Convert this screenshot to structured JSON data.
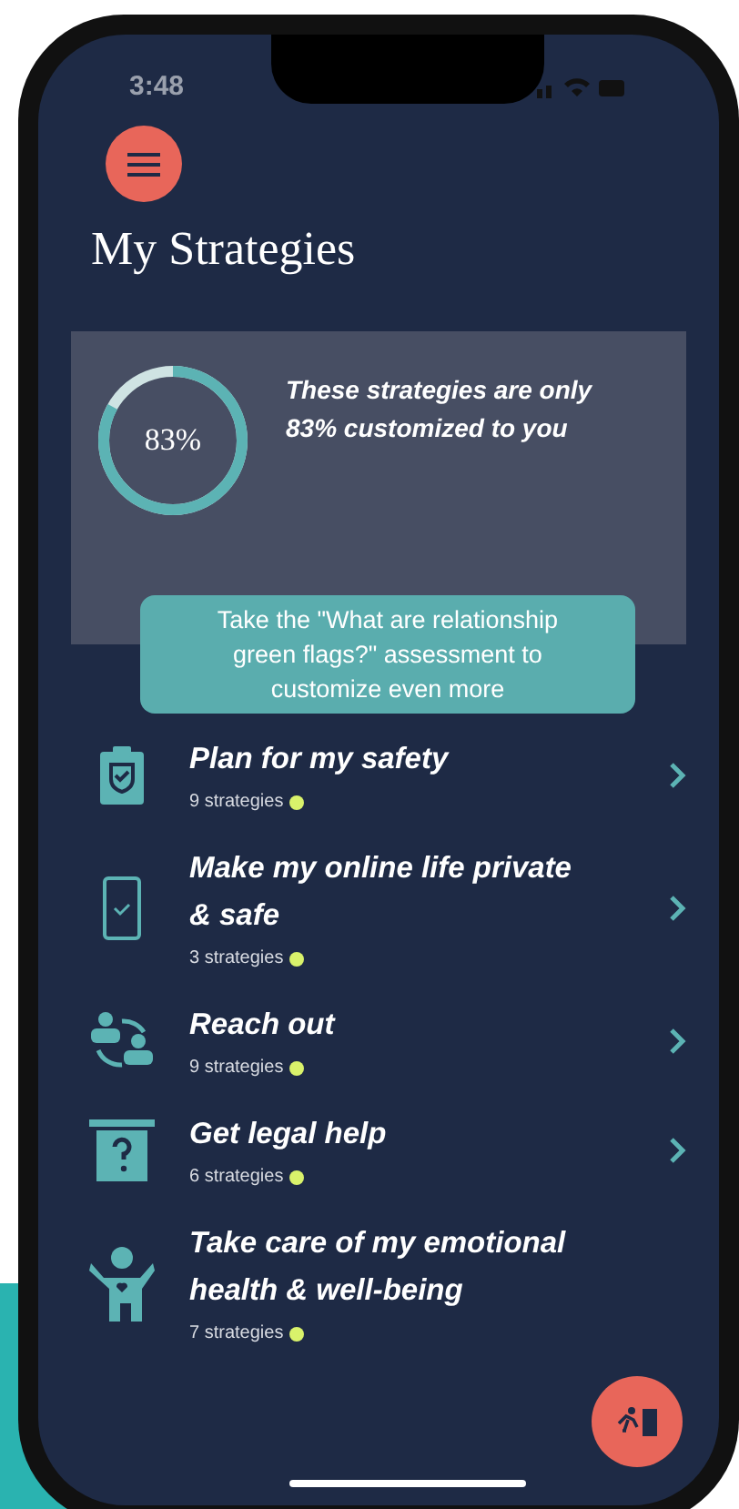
{
  "status_bar": {
    "time": "3:48"
  },
  "title": "My Strategies",
  "progress": {
    "level": 0.83,
    "reading": "83%",
    "message": "These strategies are only 83% customized to you"
  },
  "assessment_button": "Take the \"What are relationship green flags?\" assessment to customize even more",
  "categories": [
    {
      "kind": "clipboard",
      "title": "Plan for my safety",
      "count": "9 strategies",
      "color": "#d9f26b"
    },
    {
      "kind": "phone",
      "title": "Make my online life private & safe",
      "count": "3 strategies",
      "color": "#d9f26b"
    },
    {
      "kind": "people",
      "title": "Reach out",
      "count": "9 strategies",
      "color": "#d9f26b"
    },
    {
      "kind": "legal",
      "title": "Get legal help",
      "count": "6 strategies",
      "color": "#d9f26b"
    },
    {
      "kind": "wellbeing",
      "title": "Take care of my emotional health & well-being",
      "count": "7 strategies",
      "color": "#d9f26b"
    }
  ]
}
